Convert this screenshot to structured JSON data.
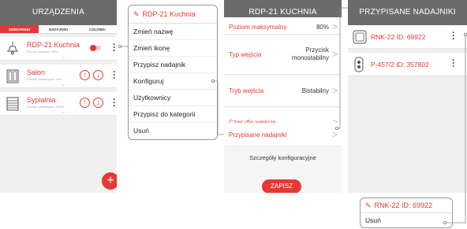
{
  "screen1": {
    "title": "URZĄDZENIA",
    "tabs": [
      "ODBIORNIKI",
      "NADAJNIKI",
      "CZUJNIKI"
    ],
    "devices": [
      {
        "name": "RDP-21 Kuchnia",
        "sub": "Poziom jasności: 49%",
        "icon": "lamp-icon"
      },
      {
        "name": "Salon",
        "sub": "Poziom zamknięcia: 16%",
        "icon": "window-blind-icon"
      },
      {
        "name": "Sypialnia",
        "sub": "Poziom zamknięcia: 100%",
        "icon": "roller-shutter-icon"
      }
    ],
    "fab": "+"
  },
  "menu": {
    "title": "RDP-21 Kuchnia",
    "items": [
      "Zmień nazwę",
      "Zmień ikonę",
      "Przypisz nadajnik",
      "Konfiguruj",
      "Użytkownicy",
      "Przypisz do kategorii",
      "Usuń"
    ]
  },
  "screen3": {
    "title": "RDP-21 KUCHNIA",
    "rows": [
      {
        "label": "Poziom maksymalny",
        "value": "80%"
      },
      {
        "label": "Typ wejścia",
        "value": "Przycisk monostabilny"
      },
      {
        "label": "Tryb wejścia",
        "value": "Bistabilny"
      },
      {
        "label": "Czas dla wejścia",
        "value": ""
      },
      {
        "label": "Przypisane nadajniki",
        "value": ""
      }
    ],
    "details": "Szczegóły konfiguracyjne",
    "save": "ZAPISZ"
  },
  "screen4": {
    "title": "PRZYPISANE NADAJNIKI",
    "items": [
      {
        "name": "RNK-22 ID: 69922",
        "icon": "wall-switch-icon"
      },
      {
        "name": "P-457/2 ID: 357802",
        "icon": "remote-control-icon"
      }
    ]
  },
  "popup": {
    "title": "RNK-22 ID: 69922",
    "items": [
      "Usuń"
    ]
  },
  "colors": {
    "accent": "#e53935",
    "header": "#6b6b6b",
    "background": "#f0f0f0"
  }
}
